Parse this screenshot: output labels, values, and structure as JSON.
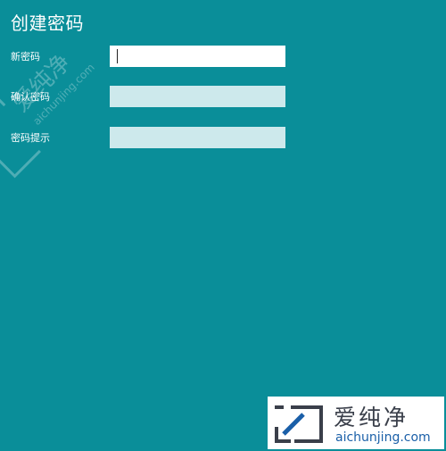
{
  "page": {
    "title": "创建密码"
  },
  "form": {
    "new_password": {
      "label": "新密码",
      "value": ""
    },
    "confirm_password": {
      "label": "确认密码",
      "value": ""
    },
    "password_hint": {
      "label": "密码提示",
      "value": ""
    }
  },
  "watermark": {
    "brand_cn": "爱纯净",
    "url": "aichunjing.com"
  },
  "colors": {
    "background": "#0a8e99",
    "input_active": "#ffffff",
    "input_inactive": "#cde9ec",
    "watermark_text": "#3a3f4a",
    "watermark_url": "#1a5fa8"
  }
}
